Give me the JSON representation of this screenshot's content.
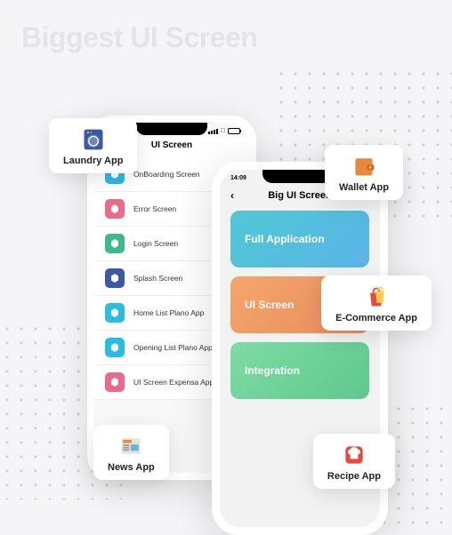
{
  "hero": {
    "title": "Biggest UI Screen"
  },
  "phone_back": {
    "header_title": "UI Screen",
    "items": [
      {
        "label": "OnBoarding Screen",
        "color": "#2bbce0"
      },
      {
        "label": "Error Screen",
        "color": "#ea6a88"
      },
      {
        "label": "Login Screen",
        "color": "#3fb98a"
      },
      {
        "label": "Splash Screen",
        "color": "#3b5aa5"
      },
      {
        "label": "Home List Plano App",
        "color": "#2bbce0"
      },
      {
        "label": "Opening List Plano App",
        "color": "#2bbce0"
      },
      {
        "label": "UI Screen Expensa App",
        "color": "#ea6a88"
      }
    ]
  },
  "phone_front": {
    "status_time": "14:09",
    "header_title": "Big UI Screen",
    "cards": [
      {
        "label": "Full Application"
      },
      {
        "label": "UI Screen"
      },
      {
        "label": "Integration"
      }
    ]
  },
  "float_cards": {
    "laundry": {
      "label": "Laundry App"
    },
    "wallet": {
      "label": "Wallet App"
    },
    "ecommerce": {
      "label": "E-Commerce App"
    },
    "news": {
      "label": "News App"
    },
    "recipe": {
      "label": "Recipe App"
    }
  }
}
